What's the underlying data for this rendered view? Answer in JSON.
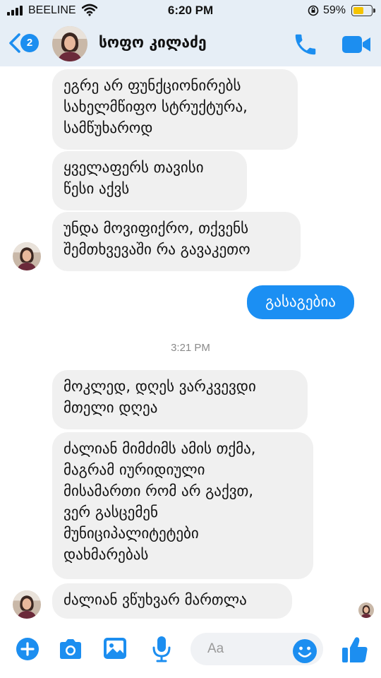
{
  "status_bar": {
    "carrier": "BEELINE",
    "time": "6:20 PM",
    "battery_percent": "59%",
    "battery_level": 0.59,
    "battery_color": "#f5c400"
  },
  "header": {
    "back_badge_count": "2",
    "contact_name": "სოფო კილაძე",
    "icons": [
      "chevron-left-icon",
      "phone-icon",
      "video-camera-icon"
    ],
    "accent_color": "#1c8ef0"
  },
  "messages": [
    {
      "direction": "in",
      "text": "ეგრე არ ფუნქციონირებს\nსახელმწიფო სტრუქტურა,\nსამწუხაროდ"
    },
    {
      "direction": "in",
      "text": "ყველაფერს თავისი\nწესი აქვს"
    },
    {
      "direction": "in",
      "text": "უნდა მოვიფიქრო, თქვენს\nშემთხვევაში რა გავაკეთო"
    },
    {
      "direction": "out",
      "text": "გასაგებია"
    },
    {
      "direction": "in",
      "text": "მოკლედ, დღეს ვარკვევდი\nმთელი დღეა"
    },
    {
      "direction": "in",
      "text": "ძალიან მიმძიმს ამის თქმა,\nმაგრამ იურიდიული\nმისამართი რომ არ გაქვთ,\nვერ გასცემენ\nმუნიციპალიტეტები\nდახმარებას"
    },
    {
      "direction": "in",
      "text": "ძალიან ვწუხვარ მართლა"
    }
  ],
  "timestamp": "3:21 PM",
  "composer": {
    "placeholder": "Aa",
    "icons": [
      "plus-icon",
      "camera-icon",
      "gallery-icon",
      "microphone-icon",
      "emoji-icon",
      "thumbs-up-icon"
    ]
  },
  "colors": {
    "outgoing_bubble": "#1b8ff3",
    "incoming_bubble": "#f0f0f0",
    "header_bg": "#e6eef6"
  }
}
